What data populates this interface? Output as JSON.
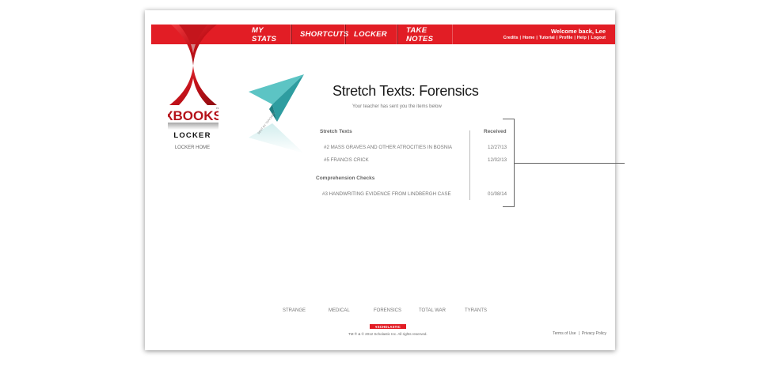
{
  "nav": {
    "items": [
      "MY STATS",
      "SHORTCUTS",
      "LOCKER",
      "TAKE NOTES"
    ],
    "welcome": "Welcome back, Lee",
    "links": [
      "Credits",
      "Home",
      "Tutorial",
      "Profile",
      "Help",
      "Logout"
    ],
    "link_separator": "|"
  },
  "sidebar": {
    "logo_text": "XBOOKS",
    "logo_trademark": "TM",
    "title": "LOCKER",
    "home_link": "LOCKER HOME"
  },
  "plane_label": "SENT BY TEACHER",
  "main": {
    "title": "Stretch Texts: Forensics",
    "subtitle": "Your teacher has sent you the items below",
    "received_header": "Received",
    "sections": [
      {
        "heading": "Stretch Texts",
        "items": [
          {
            "title": "#2 MASS GRAVES AND OTHER ATROCITIES IN BOSNIA",
            "date": "12/27/13"
          },
          {
            "title": "#5 FRANCIS CRICK",
            "date": "12/02/13"
          }
        ]
      },
      {
        "heading": "Comprehension Checks",
        "items": [
          {
            "title": "#3 HANDWRITING EVIDENCE FROM LINDBERGH CASE",
            "date": "01/08/14"
          }
        ]
      }
    ]
  },
  "footer": {
    "categories": [
      "STRANGE",
      "MEDICAL",
      "FORENSICS",
      "TOTAL WAR",
      "TYRANTS"
    ],
    "publisher": "♥SCHOLASTIC",
    "copyright": "TM ® & © 2012 Scholastic Inc. All rights reserved.",
    "terms": "Terms of Use",
    "privacy": "Privacy Policy",
    "separator": "|"
  },
  "colors": {
    "brand_red": "#e21d25",
    "plane_teal": "#4ab8b9"
  }
}
